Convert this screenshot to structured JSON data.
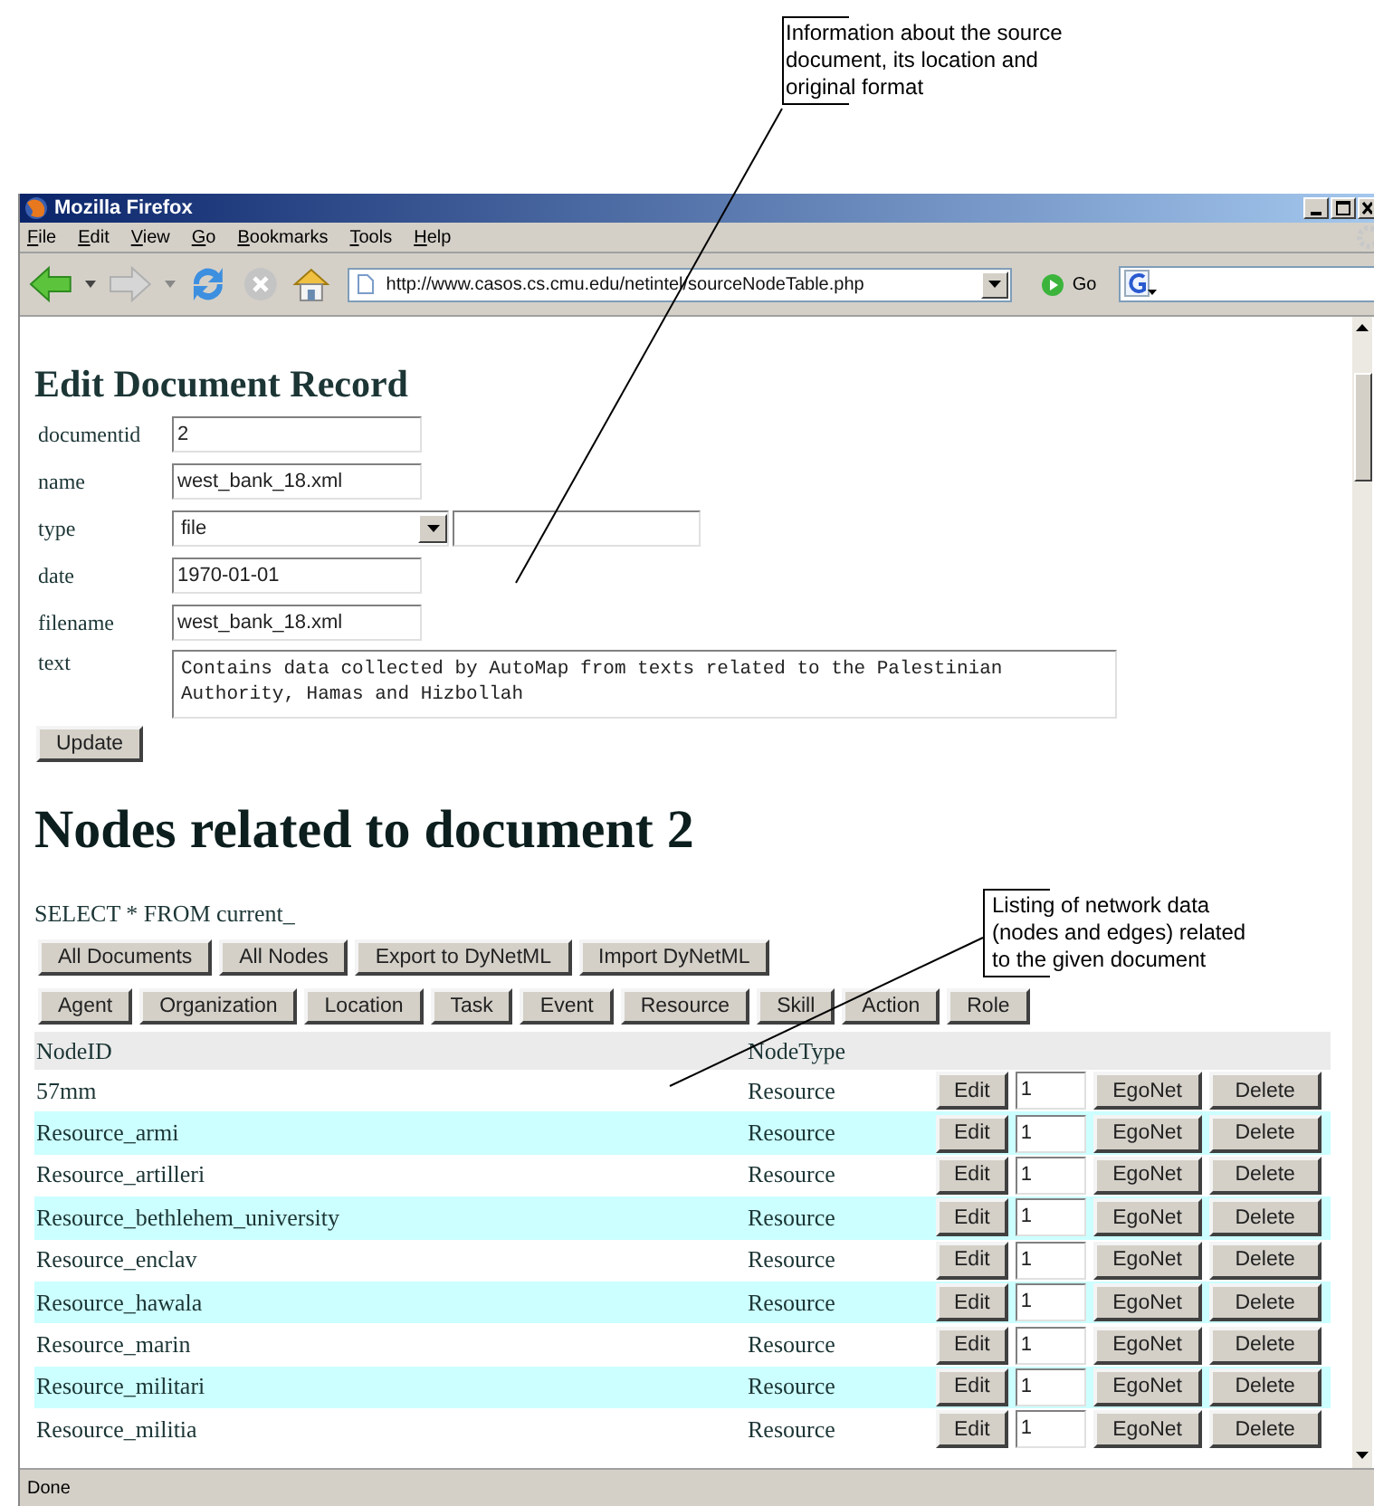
{
  "callouts": [
    {
      "text": "Information about the source document, its location and original format"
    },
    {
      "text": "Listing of network data (nodes and edges) related to the given document"
    }
  ],
  "window": {
    "title": "Mozilla Firefox"
  },
  "menu": [
    "File",
    "Edit",
    "View",
    "Go",
    "Bookmarks",
    "Tools",
    "Help"
  ],
  "toolbar": {
    "url": "http://www.casos.cs.cmu.edu/netintel/sourceNodeTable.php",
    "go": "Go"
  },
  "form": {
    "heading": "Edit Document Record",
    "fields": [
      {
        "label": "documentid",
        "kind": "input",
        "value": "2"
      },
      {
        "label": "name",
        "kind": "input",
        "value": "west_bank_18.xml"
      },
      {
        "label": "type",
        "kind": "select",
        "value": "file"
      },
      {
        "label": "date",
        "kind": "input",
        "value": "1970-01-01"
      },
      {
        "label": "filename",
        "kind": "input",
        "value": "west_bank_18.xml"
      },
      {
        "label": "text",
        "kind": "textarea",
        "value": "Contains data collected by AutoMap from texts related to the Palestinian Authority, Hamas and Hizbollah"
      }
    ],
    "submit": "Update"
  },
  "nodes": {
    "heading": "Nodes related to document 2",
    "query": "SELECT * FROM current_",
    "actions": [
      "All Documents",
      "All Nodes",
      "Export to DyNetML",
      "Import DyNetML"
    ],
    "types": [
      "Agent",
      "Organization",
      "Location",
      "Task",
      "Event",
      "Resource",
      "Skill",
      "Action",
      "Role"
    ],
    "columns": [
      "NodeID",
      "NodeType"
    ],
    "rows": [
      {
        "id": "57mm",
        "type": "Resource",
        "edit": "Edit",
        "count": "1",
        "egonet": "EgoNet",
        "delete": "Delete"
      },
      {
        "id": "Resource_armi",
        "type": "Resource",
        "edit": "Edit",
        "count": "1",
        "egonet": "EgoNet",
        "delete": "Delete"
      },
      {
        "id": "Resource_artilleri",
        "type": "Resource",
        "edit": "Edit",
        "count": "1",
        "egonet": "EgoNet",
        "delete": "Delete"
      },
      {
        "id": "Resource_bethlehem_university",
        "type": "Resource",
        "edit": "Edit",
        "count": "1",
        "egonet": "EgoNet",
        "delete": "Delete"
      },
      {
        "id": "Resource_enclav",
        "type": "Resource",
        "edit": "Edit",
        "count": "1",
        "egonet": "EgoNet",
        "delete": "Delete"
      },
      {
        "id": "Resource_hawala",
        "type": "Resource",
        "edit": "Edit",
        "count": "1",
        "egonet": "EgoNet",
        "delete": "Delete"
      },
      {
        "id": "Resource_marin",
        "type": "Resource",
        "edit": "Edit",
        "count": "1",
        "egonet": "EgoNet",
        "delete": "Delete"
      },
      {
        "id": "Resource_militari",
        "type": "Resource",
        "edit": "Edit",
        "count": "1",
        "egonet": "EgoNet",
        "delete": "Delete"
      },
      {
        "id": "Resource_militia",
        "type": "Resource",
        "edit": "Edit",
        "count": "1",
        "egonet": "EgoNet",
        "delete": "Delete"
      }
    ]
  },
  "status_bar": "Done"
}
